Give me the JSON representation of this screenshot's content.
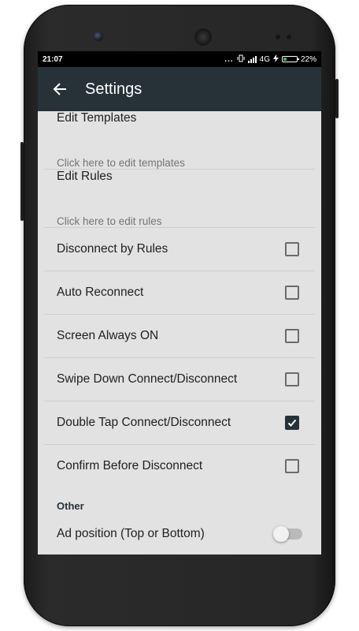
{
  "status_bar": {
    "time": "21:07",
    "notification_dots": "...",
    "network": "4G",
    "battery_percent": "22%",
    "battery_level": 0.22
  },
  "toolbar": {
    "title": "Settings",
    "back_icon": "arrow-back-icon",
    "color": "#263238"
  },
  "preferences": {
    "edit_templates": {
      "title": "Edit Templates",
      "summary": "Click here to edit templates"
    },
    "edit_rules": {
      "title": "Edit Rules",
      "summary": "Click here to edit rules"
    },
    "toggles": [
      {
        "title": "Disconnect by Rules",
        "checked": false
      },
      {
        "title": "Auto Reconnect",
        "checked": false
      },
      {
        "title": "Screen Always ON",
        "checked": false
      },
      {
        "title": "Swipe Down Connect/Disconnect",
        "checked": false
      },
      {
        "title": "Double Tap Connect/Disconnect",
        "checked": true
      },
      {
        "title": "Confirm Before Disconnect",
        "checked": false
      }
    ],
    "other_category": "Other",
    "ad_position": {
      "title": "Ad position (Top or Bottom)",
      "on": false
    }
  }
}
